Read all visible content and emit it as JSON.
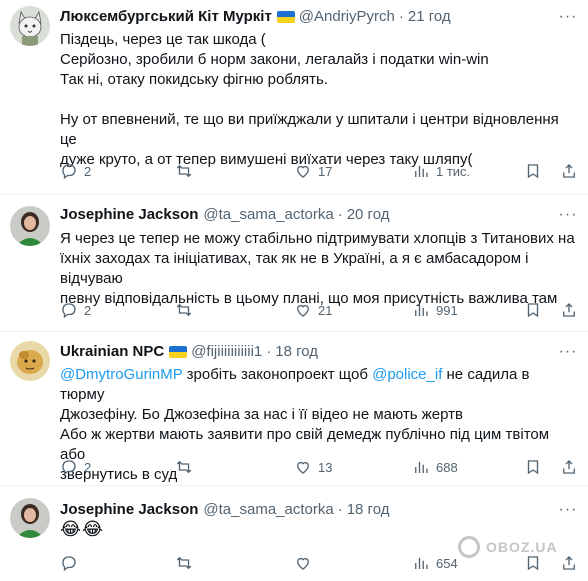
{
  "tweets": [
    {
      "name": "Люксембургський Кіт Муркіт",
      "handle": "@AndriyPyrch",
      "time": "21 год",
      "lines": [
        "Піздець, через це так шкода (",
        "Серйозно, зробили б норм закони, легалайз і податки win-win",
        "Так ні, отаку покидську фігню роблять.",
        "",
        "Ну от впевнений, те що ви приїжджали у шпитали і центри відновлення це",
        "дуже круто, а от тепер вимушені виїхати через таку шляпу("
      ],
      "replies": "2",
      "retweets": "",
      "likes": "17",
      "views": "1 тис."
    },
    {
      "name": "Josephine Jackson",
      "handle": "@ta_sama_actorka",
      "time": "20 год",
      "lines": [
        "Я через це тепер не можу стабільно підтримувати хлопців з Титанових на",
        "їхніх заходах та ініціативах, так як не в Україні, а я є амбасадором і відчуваю",
        "певну відповідальність в цьому плані, що моя присутність важлива там"
      ],
      "replies": "2",
      "retweets": "",
      "likes": "21",
      "views": "991"
    },
    {
      "name": "Ukrainian NPC",
      "handle": "@fijiiiiiiiiiii1",
      "time": "18 год",
      "mention1": "@DmytroGurinMP",
      "line1_mid": " зробіть законопроект щоб ",
      "mention2": "@police_if",
      "line1_end": " не садила в тюрму",
      "lines": [
        "Джозефіну. Бо Джозефіна за нас і її відео не мають жертв",
        "Або ж жертви мають заявити про свій демедж публічно під цим твітом  або",
        "звернутись в суд"
      ],
      "replies": "2",
      "retweets": "",
      "likes": "13",
      "views": "688"
    },
    {
      "name": "Josephine Jackson",
      "handle": "@ta_sama_actorka",
      "time": "18 год",
      "emoji": "😂😂",
      "replies": "",
      "retweets": "",
      "likes": "",
      "views": "654"
    }
  ],
  "dot": "·",
  "watermark": "OBOZ.UA",
  "icons": [
    "reply-icon",
    "retweet-icon",
    "like-icon",
    "views-icon",
    "bookmark-icon",
    "share-icon",
    "more-icon"
  ]
}
